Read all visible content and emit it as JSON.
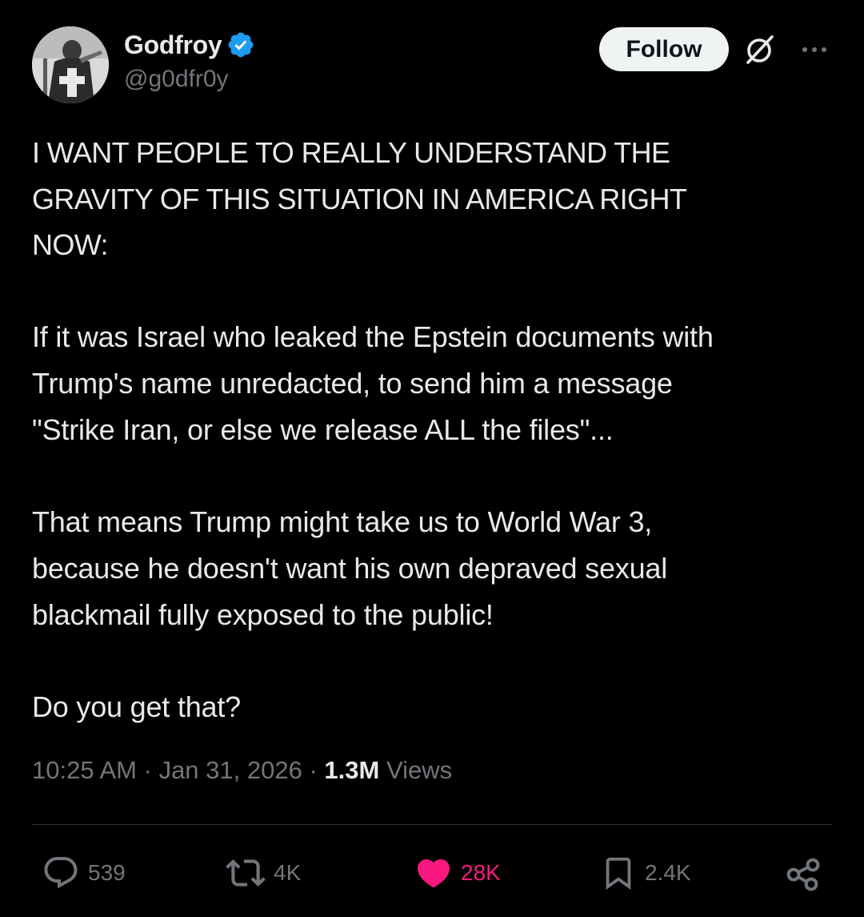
{
  "author": {
    "display_name": "Godfroy",
    "handle": "@g0dfr0y",
    "verified": true,
    "verified_color": "#1d9bf0"
  },
  "header": {
    "follow_label": "Follow",
    "icons": [
      "grok-icon",
      "more-icon"
    ]
  },
  "tweet": {
    "paragraphs": [
      "I WANT PEOPLE TO REALLY UNDERSTAND THE\nGRAVITY OF THIS SITUATION IN AMERICA RIGHT\nNOW:",
      "If it was Israel who leaked the Epstein documents with\nTrump's name unredacted, to send him a message\n\"Strike Iran, or else we release ALL the files\"...",
      "That means Trump might take us to World War 3,\nbecause he doesn't want his own depraved sexual\nblackmail fully exposed to the public!",
      "Do you get that?"
    ]
  },
  "meta": {
    "time": "10:25 AM",
    "separator": "·",
    "date": "Jan 31, 2026",
    "views_count": "1.3M",
    "views_label": "Views"
  },
  "actions": {
    "replies": "539",
    "reposts": "4K",
    "likes": "28K",
    "bookmarks": "2.4K",
    "liked": true,
    "like_color": "#f91880"
  }
}
